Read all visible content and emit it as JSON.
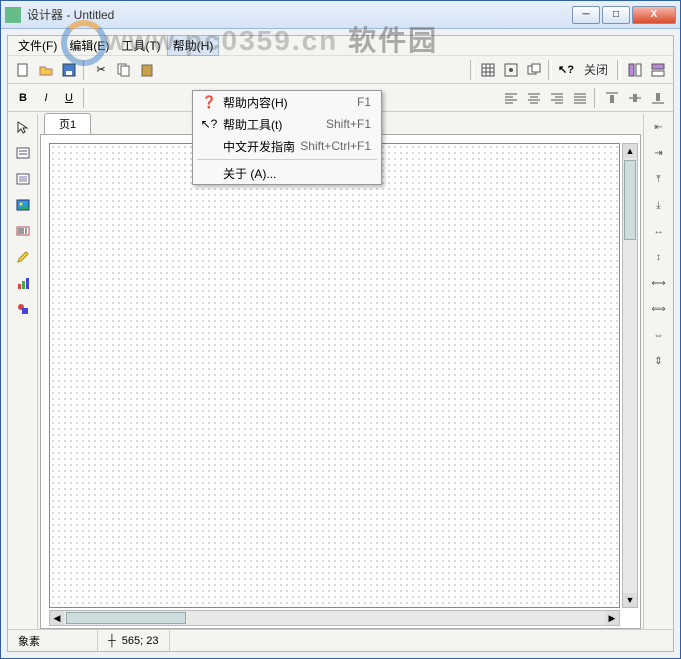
{
  "title": "设计器 - Untitled",
  "watermark": "www.pc0359.cn",
  "watermark_suffix": "软件园",
  "menubar": {
    "file": "文件(F)",
    "edit": "编辑(E)",
    "tools": "工具(T)",
    "help": "帮助(H)"
  },
  "help_menu": {
    "contents": {
      "label": "帮助内容(H)",
      "shortcut": "F1"
    },
    "helptool": {
      "label": "帮助工具(t)",
      "shortcut": "Shift+F1"
    },
    "cnguide": {
      "label": "中文开发指南",
      "shortcut": "Shift+Ctrl+F1"
    },
    "about": {
      "label": "关于 (A)...",
      "shortcut": ""
    }
  },
  "toolbar": {
    "close_label": "关闭"
  },
  "tab": {
    "page1": "页1"
  },
  "status": {
    "left": "象素",
    "coords": "565; 23"
  }
}
